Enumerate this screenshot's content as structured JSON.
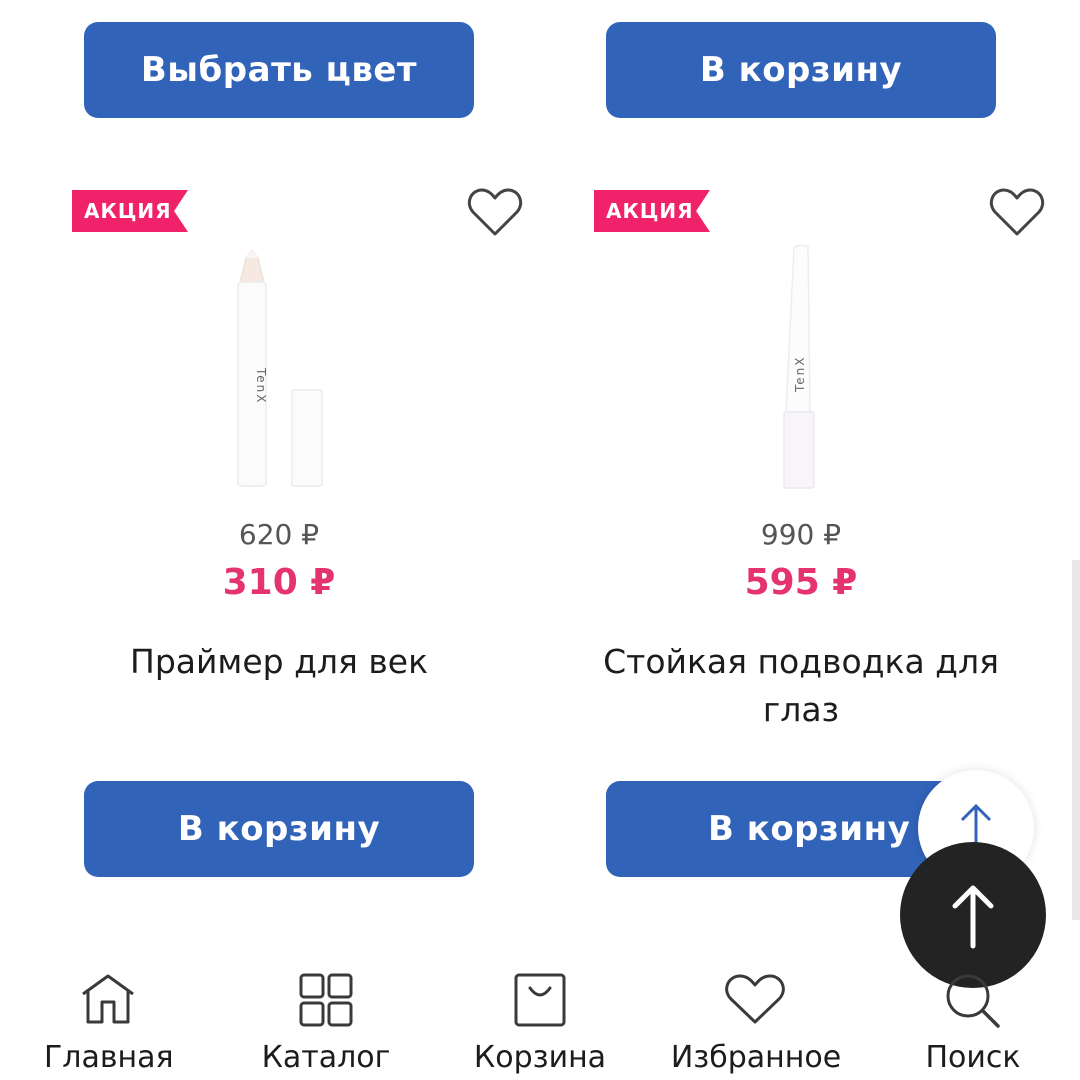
{
  "top_buttons": {
    "left_label": "Выбрать цвет",
    "right_label": "В корзину"
  },
  "products": [
    {
      "badge": "АКЦИЯ",
      "brand": "TenX",
      "old_price": "620 ₽",
      "new_price": "310 ₽",
      "title": "Праймер для век",
      "cart_label": "В корзину"
    },
    {
      "badge": "АКЦИЯ",
      "brand": "TenX",
      "old_price": "990 ₽",
      "new_price": "595 ₽",
      "title": "Стойкая подводка для глаз",
      "cart_label": "В корзину"
    }
  ],
  "bottom_nav": [
    {
      "label": "Главная",
      "icon": "home-icon"
    },
    {
      "label": "Каталог",
      "icon": "catalog-icon"
    },
    {
      "label": "Корзина",
      "icon": "bag-icon"
    },
    {
      "label": "Избранное",
      "icon": "heart-icon"
    },
    {
      "label": "Поиск",
      "icon": "search-icon"
    }
  ],
  "colors": {
    "button": "#3163b9",
    "badge": "#f0226a",
    "price": "#e5336f",
    "scroll_top": "#232323"
  }
}
